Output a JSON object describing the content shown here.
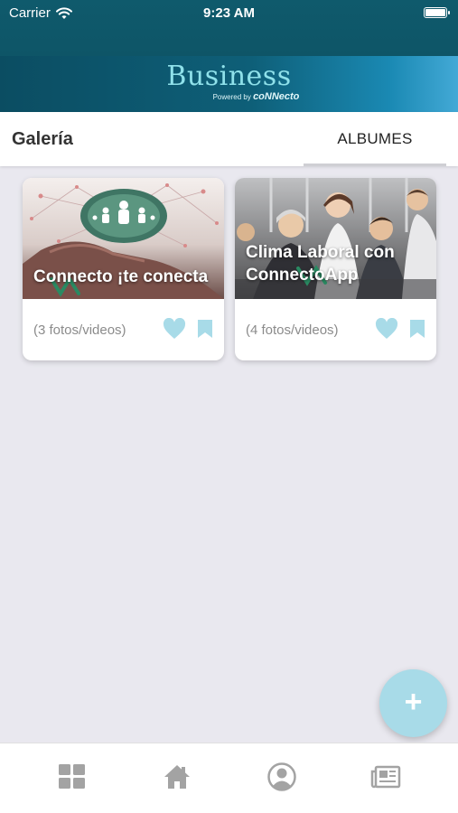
{
  "status_bar": {
    "carrier": "Carrier",
    "time": "9:23 AM"
  },
  "brand": {
    "name": "Business",
    "powered_by": "Powered by",
    "powered_brand": "coNNecto"
  },
  "header": {
    "title": "Galería",
    "active_tab": "ALBUMES"
  },
  "albums": [
    {
      "title": "Connecto ¡te conecta",
      "count": "(3 fotos/videos)",
      "favorite_icon": "heart-icon",
      "save_icon": "bookmark-icon"
    },
    {
      "title_line1": "Clima Laboral con",
      "title_line2": "ConnectoApp",
      "count": "(4 fotos/videos)",
      "favorite_icon": "heart-icon",
      "save_icon": "bookmark-icon"
    }
  ],
  "fab": {
    "label": "+"
  },
  "bottom_nav": [
    "grid-icon",
    "home-icon",
    "profile-icon",
    "news-icon"
  ],
  "colors": {
    "accent": "#a8dbe8",
    "header": "#0e5567",
    "nav_icon": "#a3a3a3"
  }
}
